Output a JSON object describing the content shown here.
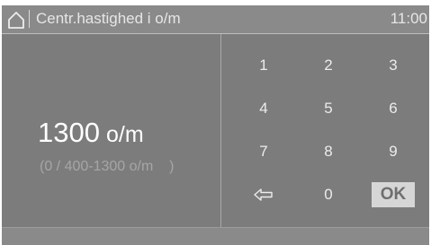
{
  "header": {
    "title": "Centr.hastighed i o/m",
    "time": "11:00",
    "home_icon": "home-icon"
  },
  "display": {
    "value": "1300",
    "unit": "o/m",
    "range": "(0 / 400-1300 o/m    )"
  },
  "keypad": {
    "keys": [
      "1",
      "2",
      "3",
      "4",
      "5",
      "6",
      "7",
      "8",
      "9",
      "⇦",
      "0",
      "OK"
    ],
    "backspace_icon": "backspace-arrow-icon"
  },
  "colors": {
    "panel": "#7c7c7c",
    "header": "#8a8a8a",
    "ok_button": "#d6d6d6",
    "text": "#ffffff",
    "muted_text": "#a6a6a6"
  }
}
